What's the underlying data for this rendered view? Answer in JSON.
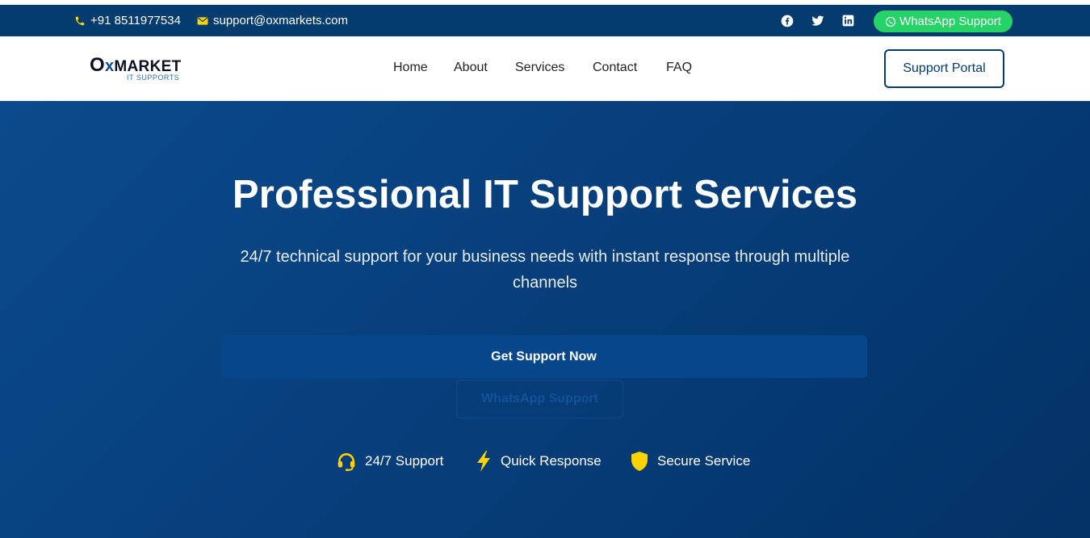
{
  "topbar": {
    "phone": "+91 8511977534",
    "email": "support@oxmarkets.com",
    "whatsapp_label": "WhatsApp Support"
  },
  "logo": {
    "o": "O",
    "x": "x",
    "market": "MARKET",
    "tagline": "IT SUPPORTS"
  },
  "nav": {
    "items": [
      {
        "label": "Home"
      },
      {
        "label": "About"
      },
      {
        "label": "Services"
      },
      {
        "label": "Contact"
      },
      {
        "label": "FAQ"
      }
    ],
    "portal_label": "Support Portal"
  },
  "hero": {
    "title": "Professional IT Support Services",
    "subtitle": "24/7 technical support for your business needs with instant response through multiple channels",
    "cta_label": "Get Support Now",
    "secondary_label": "WhatsApp Support",
    "features": [
      {
        "label": "24/7 Support",
        "icon": "headset-icon"
      },
      {
        "label": "Quick Response",
        "icon": "bolt-icon"
      },
      {
        "label": "Secure Service",
        "icon": "shield-icon"
      }
    ]
  },
  "colors": {
    "primary": "#043c6f",
    "accent_yellow": "#ffd200",
    "whatsapp_green": "#25d366",
    "hero_bg": "#0b4a8c"
  }
}
